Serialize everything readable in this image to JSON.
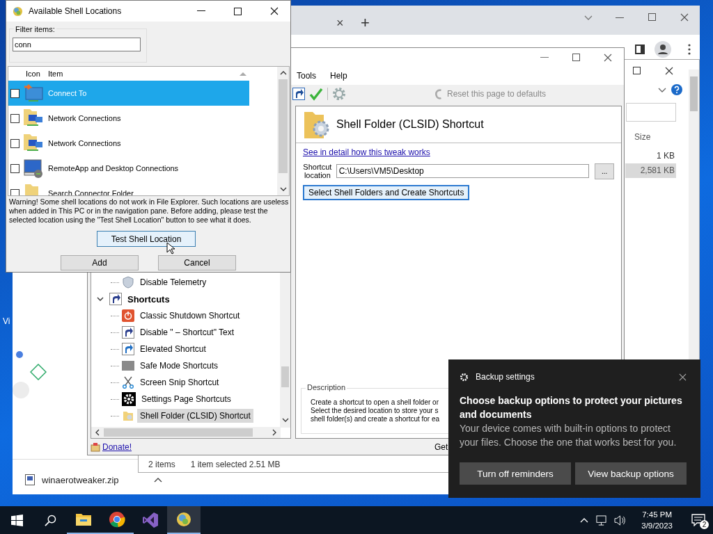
{
  "desktop": {
    "icon_labels": [
      "Vi"
    ]
  },
  "browser": {
    "tab_close": "×",
    "new_tab": "+",
    "download": {
      "file": "winaerotweaker.zip"
    }
  },
  "explorer": {
    "columns": [
      "Size"
    ],
    "rows": [
      {
        "size": "1 KB",
        "selected": false
      },
      {
        "size": "2,581 KB",
        "selected": true
      }
    ],
    "status": [
      "2 items",
      "1 item selected  2.51 MB"
    ]
  },
  "tweaker": {
    "menu": [
      "Tools",
      "Help"
    ],
    "reset": "Reset this page to defaults",
    "tree": [
      {
        "children": [
          {
            "label": "Disable Telemetry",
            "kind": "shield",
            "selected": false
          }
        ]
      },
      {
        "label": "Shortcuts",
        "kind": "shortcut",
        "expanded": true,
        "selected": false,
        "children": [
          {
            "label": "Classic Shutdown Shortcut",
            "kind": "power",
            "selected": false
          },
          {
            "label": "Disable \" – Shortcut\" Text",
            "kind": "shortcut",
            "selected": false
          },
          {
            "label": "Elevated Shortcut",
            "kind": "elevated",
            "selected": false
          },
          {
            "label": "Safe Mode Shortcuts",
            "kind": "safemode",
            "selected": false
          },
          {
            "label": "Screen Snip Shortcut",
            "kind": "scissors",
            "selected": false
          },
          {
            "label": "Settings Page Shortcuts",
            "kind": "gear",
            "selected": false
          },
          {
            "label": "Shell Folder (CLSID) Shortcut",
            "kind": "folder",
            "selected": true
          }
        ]
      }
    ],
    "page": {
      "title": "Shell Folder (CLSID) Shortcut",
      "link": "See in detail how this tweak works",
      "location_label": "Shortcut location",
      "location": "C:\\Users\\VM5\\Desktop",
      "browse": "...",
      "action": "Select Shell Folders and Create Shortcuts"
    },
    "description": {
      "label": "Description",
      "lines": [
        "Create a shortcut to open a shell folder or",
        "Select the desired location to store your s",
        "shell folder(s) and create a shortcut for ea"
      ]
    },
    "footer": {
      "donate": "Donate!",
      "right": "Get"
    }
  },
  "dialog": {
    "title": "Available Shell Locations",
    "filter_label": "Filter items:",
    "filter_value": "conn",
    "columns": [
      "Icon",
      "Item"
    ],
    "items": [
      {
        "label": "Connect To",
        "kind": "connect",
        "checked": false,
        "selected": true
      },
      {
        "label": "Network Connections",
        "kind": "network",
        "checked": false,
        "selected": false
      },
      {
        "label": "Network Connections",
        "kind": "network",
        "checked": false,
        "selected": false
      },
      {
        "label": "RemoteApp and Desktop Connections",
        "kind": "remote",
        "checked": false,
        "selected": false
      },
      {
        "label": "Search Connector Folder",
        "kind": "folder",
        "checked": false,
        "selected": false
      }
    ],
    "warning": "Warning! Some shell locations do not work in File Explorer. Such locations are useless when added in This PC or in the navigation pane. Before adding, please test the selected location using the \"Test Shell Location\" button to see what it does.",
    "test_button": "Test Shell Location",
    "buttons": [
      "Add",
      "Cancel"
    ]
  },
  "toast": {
    "app": "Backup settings",
    "title": "Choose backup options to protect your pictures and documents",
    "body": "Your device comes with built-in options to protect your files. Choose the one that works best for you.",
    "buttons": [
      "Turn off reminders",
      "View backup options"
    ]
  },
  "taskbar": {
    "apps": [
      {
        "kind": "start",
        "running": false,
        "active": false
      },
      {
        "kind": "search",
        "running": false,
        "active": false
      },
      {
        "kind": "folder",
        "running": true,
        "active": false
      },
      {
        "kind": "chrome",
        "running": true,
        "active": false
      },
      {
        "kind": "studio",
        "running": false,
        "active": false
      },
      {
        "kind": "tweaker",
        "running": true,
        "active": true
      }
    ],
    "time": "7:45 PM",
    "date": "3/9/2023",
    "notifications": "2"
  }
}
